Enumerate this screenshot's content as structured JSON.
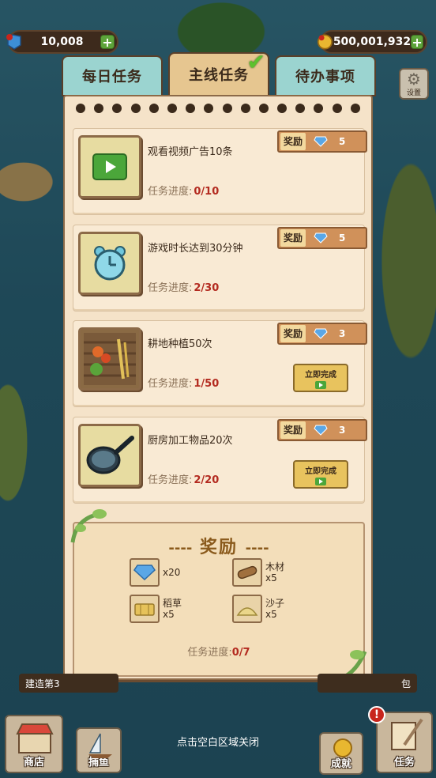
{
  "currency": {
    "left_value": "10,008",
    "right_value": "500,001,932",
    "plus_label": "+"
  },
  "tabs": [
    {
      "label": "每日任务"
    },
    {
      "label": "主线任务",
      "checked": true
    },
    {
      "label": "待办事项"
    }
  ],
  "settings": {
    "label": "设置"
  },
  "tasks": [
    {
      "title": "观看视频广告10条",
      "progress_label": "任务进度:",
      "progress": "0/10",
      "reward_label": "奖励",
      "reward_value": "5",
      "icon": "play-video-icon",
      "has_finish_button": false
    },
    {
      "title": "游戏时长达到30分钟",
      "progress_label": "任务进度:",
      "progress": "2/30",
      "reward_label": "奖励",
      "reward_value": "5",
      "icon": "alarm-clock-icon",
      "has_finish_button": false
    },
    {
      "title": "耕地种植50次",
      "progress_label": "任务进度:",
      "progress": "1/50",
      "reward_label": "奖励",
      "reward_value": "3",
      "icon": "farm-field-icon",
      "has_finish_button": true,
      "finish_label": "立即完成"
    },
    {
      "title": "厨房加工物品20次",
      "progress_label": "任务进度:",
      "progress": "2/20",
      "reward_label": "奖励",
      "reward_value": "3",
      "icon": "frying-pan-icon",
      "has_finish_button": true,
      "finish_label": "立即完成"
    }
  ],
  "reward_box": {
    "title": "奖励",
    "dash": "----",
    "items": [
      {
        "name": "",
        "qty": "x20",
        "icon": "diamond-icon"
      },
      {
        "name": "木材",
        "qty": "x5",
        "icon": "wood-log-icon"
      },
      {
        "name": "稻草",
        "qty": "x5",
        "icon": "hay-bale-icon"
      },
      {
        "name": "沙子",
        "qty": "x5",
        "icon": "sand-pile-icon"
      }
    ],
    "progress_label": "任务进度:",
    "progress": "0/7"
  },
  "bottom": {
    "quest_left": "建造第3",
    "quest_right": "包",
    "close_hint": "点击空白区域关闭",
    "nav": [
      {
        "label": "商店",
        "icon": "shop-icon"
      },
      {
        "label": "捕鱼",
        "icon": "sailboat-icon"
      },
      {
        "label": "成就",
        "icon": "medal-icon"
      },
      {
        "label": "任务",
        "icon": "scroll-quill-icon"
      }
    ],
    "alert_mark": "!"
  },
  "colors": {
    "panel_bg": "#f5e3c9",
    "tab_active": "#e6c690",
    "tab_inactive": "#9bd4d0",
    "progress_value": "#b32a1f",
    "gem": "#5aa7e6"
  }
}
